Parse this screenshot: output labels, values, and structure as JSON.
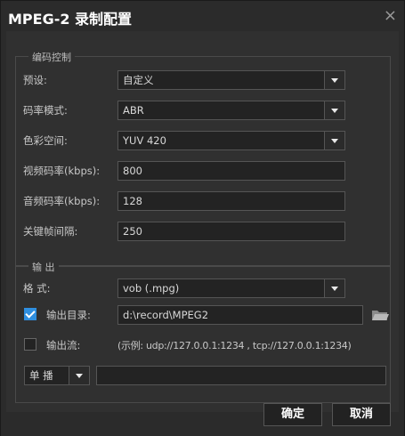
{
  "window": {
    "title": "MPEG-2 录制配置",
    "close_glyph": "×"
  },
  "encoding": {
    "legend": "编码控制",
    "preset_label": "预设:",
    "preset_value": "自定义",
    "rate_mode_label": "码率模式:",
    "rate_mode_value": "ABR",
    "color_space_label": "色彩空间:",
    "color_space_value": "YUV 420",
    "video_bitrate_label": "视频码率(kbps):",
    "video_bitrate_value": "800",
    "audio_bitrate_label": "音频码率(kbps):",
    "audio_bitrate_value": "128",
    "keyframe_interval_label": "关键帧间隔:",
    "keyframe_interval_value": "250"
  },
  "output": {
    "legend": "输 出",
    "format_label": "格 式:",
    "format_value": "vob (.mpg)",
    "dir_checkbox_checked": true,
    "dir_label": "输出目录:",
    "dir_value": "d:\\record\\MPEG2",
    "stream_checkbox_checked": false,
    "stream_label": "输出流:",
    "stream_hint": "(示例: udp://127.0.0.1:1234 , tcp://127.0.0.1:1234)",
    "cast_mode_value": "单 播",
    "stream_url_value": ""
  },
  "buttons": {
    "ok": "确定",
    "cancel": "取消"
  },
  "colors": {
    "accent": "#2f8fe0",
    "background": "#303030",
    "field_bg": "#232323"
  }
}
